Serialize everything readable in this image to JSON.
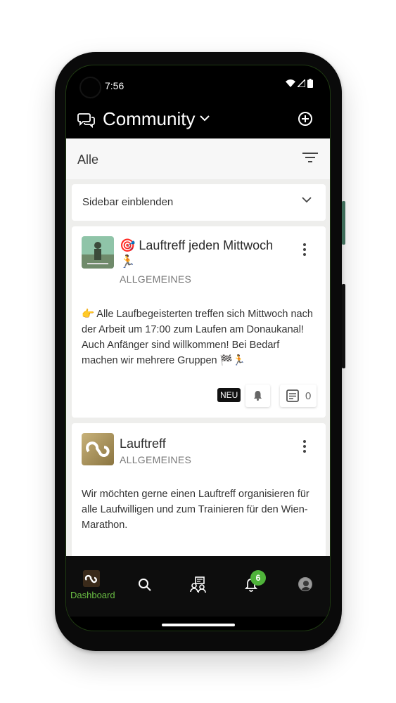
{
  "status": {
    "time": "7:56"
  },
  "header": {
    "title": "Community"
  },
  "filter": {
    "label": "Alle"
  },
  "sidebar_toggle": {
    "label": "Sidebar einblenden"
  },
  "posts": [
    {
      "title": "🎯 Lauftreff jeden Mittwoch 🏃",
      "category": "ALLGEMEINES",
      "text": "👉 Alle Laufbegeisterten treffen sich Mittwoch nach der Arbeit um 17:00 zum Laufen am Donaukanal! Auch Anfänger sind willkommen! Bei Bedarf machen wir mehrere Gruppen 🏁🏃",
      "badge": "NEU",
      "comment_count": "0"
    },
    {
      "title": "Lauftreff",
      "category": "ALLGEMEINES",
      "text": "Wir möchten gerne einen Lauftreff organisieren für alle Laufwilligen und zum Trainieren für den Wien-Marathon."
    }
  ],
  "bottom_nav": {
    "dashboard_label": "Dashboard",
    "notification_count": "6",
    "active_color": "#6bbf44"
  }
}
